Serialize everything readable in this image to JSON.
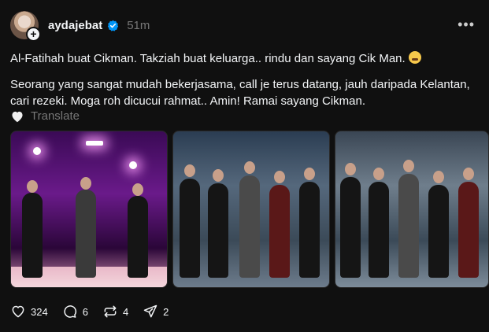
{
  "post": {
    "username": "aydajebat",
    "time": "51m",
    "line1": "Al-Fatihah buat Cikman. Takziah buat keluarga.. rindu dan sayang Cik Man.",
    "line2": "Seorang yang sangat mudah bekerjasama, call je terus datang, jauh daripada Kelantan, cari rezeki. Moga roh dicucui rahmat.. Amin! Ramai sayang Cikman.",
    "translate_label": "Translate"
  },
  "actions": {
    "likes": "324",
    "replies": "6",
    "reposts": "4",
    "shares": "2"
  },
  "icons": {
    "verified": "verified-badge-icon",
    "more": "more-options-icon",
    "emoji": "crying-cat-emoji",
    "heart_emoji": "white-heart-emoji",
    "like": "heart-icon",
    "reply": "comment-bubble-icon",
    "repost": "repost-icon",
    "share": "send-icon"
  },
  "colors": {
    "background": "#101010",
    "text": "#f3f5f7",
    "muted": "#777777",
    "verified": "#0095f6"
  }
}
